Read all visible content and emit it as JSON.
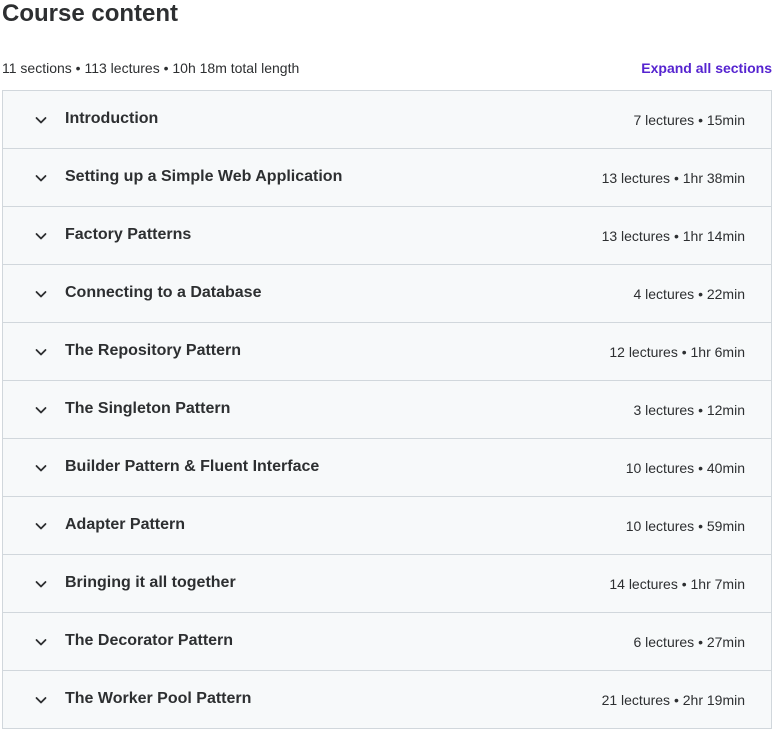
{
  "header": {
    "title": "Course content",
    "summary": "11 sections • 113 lectures • 10h 18m total length",
    "expand_label": "Expand all sections"
  },
  "colors": {
    "accent": "#5624d0",
    "text": "#2d2f31",
    "row_background": "#f7f9fa",
    "border": "#d1d7dc"
  },
  "sections": [
    {
      "title": "Introduction",
      "meta": "7 lectures • 15min",
      "icon": "chevron-down-icon"
    },
    {
      "title": "Setting up a Simple Web Application",
      "meta": "13 lectures • 1hr 38min",
      "icon": "chevron-down-icon"
    },
    {
      "title": "Factory Patterns",
      "meta": "13 lectures • 1hr 14min",
      "icon": "chevron-down-icon"
    },
    {
      "title": "Connecting to a Database",
      "meta": "4 lectures • 22min",
      "icon": "chevron-down-icon"
    },
    {
      "title": "The Repository Pattern",
      "meta": "12 lectures • 1hr 6min",
      "icon": "chevron-down-icon"
    },
    {
      "title": "The Singleton Pattern",
      "meta": "3 lectures • 12min",
      "icon": "chevron-down-icon"
    },
    {
      "title": "Builder Pattern & Fluent Interface",
      "meta": "10 lectures • 40min",
      "icon": "chevron-down-icon"
    },
    {
      "title": "Adapter Pattern",
      "meta": "10 lectures • 59min",
      "icon": "chevron-down-icon"
    },
    {
      "title": "Bringing it all together",
      "meta": "14 lectures • 1hr 7min",
      "icon": "chevron-down-icon"
    },
    {
      "title": "The Decorator Pattern",
      "meta": "6 lectures • 27min",
      "icon": "chevron-down-icon"
    },
    {
      "title": "The Worker Pool Pattern",
      "meta": "21 lectures • 2hr 19min",
      "icon": "chevron-down-icon"
    }
  ]
}
